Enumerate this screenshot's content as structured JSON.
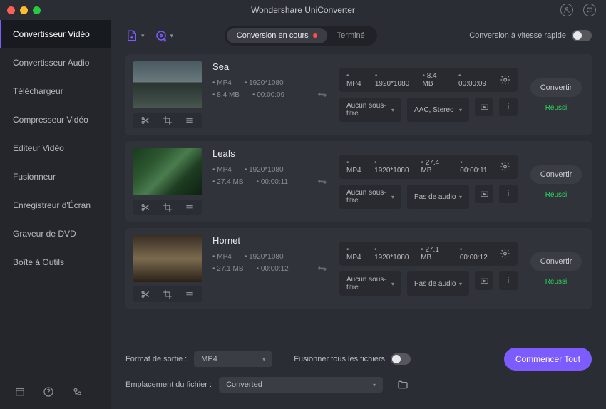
{
  "app_title": "Wondershare UniConverter",
  "sidebar": {
    "items": [
      "Convertisseur Vidéo",
      "Convertisseur Audio",
      "Téléchargeur",
      "Compresseur Vidéo",
      "Editeur Vidéo",
      "Fusionneur",
      "Enregistreur d'Écran",
      "Graveur de DVD",
      "Boîte à Outils"
    ],
    "active_index": 0
  },
  "toolbar": {
    "tabs": {
      "active": "Conversion en cours",
      "done": "Terminé"
    },
    "fast_label": "Conversion à vitesse rapide"
  },
  "videos": [
    {
      "title": "Sea",
      "thumb_class": "th-sea",
      "src": {
        "format": "MP4",
        "res": "1920*1080",
        "size": "8.4 MB",
        "dur": "00:00:09"
      },
      "out": {
        "format": "MP4",
        "res": "1920*1080",
        "size": "8.4 MB",
        "dur": "00:00:09"
      },
      "subtitle": "Aucun sous-titre",
      "audio": "AAC, Stereo",
      "action": "Convertir",
      "status": "Réussi"
    },
    {
      "title": "Leafs",
      "thumb_class": "th-leafs",
      "src": {
        "format": "MP4",
        "res": "1920*1080",
        "size": "27.4 MB",
        "dur": "00:00:11"
      },
      "out": {
        "format": "MP4",
        "res": "1920*1080",
        "size": "27.4 MB",
        "dur": "00:00:11"
      },
      "subtitle": "Aucun sous-titre",
      "audio": "Pas de audio",
      "action": "Convertir",
      "status": "Réussi"
    },
    {
      "title": "Hornet",
      "thumb_class": "th-hornet",
      "src": {
        "format": "MP4",
        "res": "1920*1080",
        "size": "27.1 MB",
        "dur": "00:00:12"
      },
      "out": {
        "format": "MP4",
        "res": "1920*1080",
        "size": "27.1 MB",
        "dur": "00:00:12"
      },
      "subtitle": "Aucun sous-titre",
      "audio": "Pas de audio",
      "action": "Convertir",
      "status": "Réussi"
    }
  ],
  "footer": {
    "format_label": "Format de sortie :",
    "format_value": "MP4",
    "merge_label": "Fusionner tous les fichiers",
    "location_label": "Emplacement du fichier :",
    "location_value": "Converted",
    "start_label": "Commencer Tout"
  }
}
